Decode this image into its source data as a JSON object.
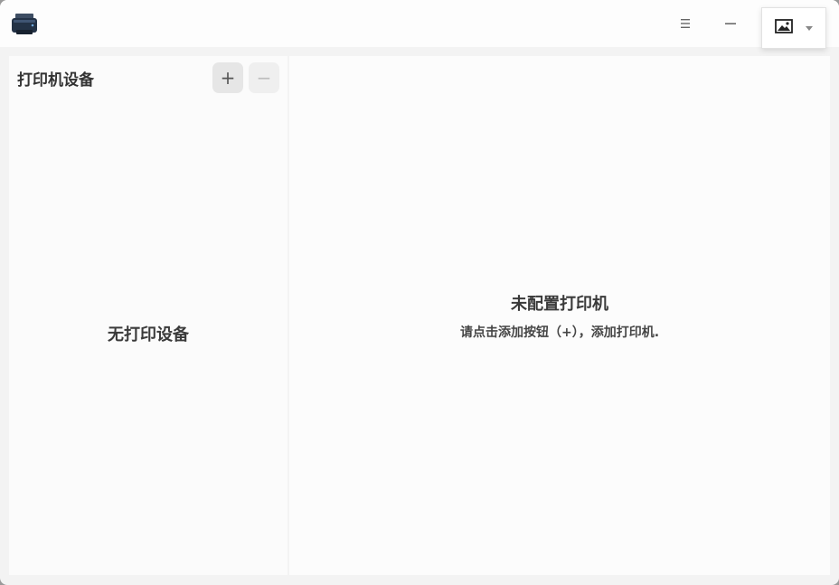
{
  "app": {
    "icon": "printer-icon"
  },
  "titlebar": {
    "menu_icon": "hamburger-menu-icon",
    "minimize_icon": "minimize-icon",
    "maximize_icon": "maximize-icon",
    "close_icon": "close-icon",
    "popup_icon": "image-icon"
  },
  "sidebar": {
    "title": "打印机设备",
    "add_label": "+",
    "remove_label": "−",
    "empty_text": "无打印设备"
  },
  "main": {
    "empty_title": "未配置打印机",
    "empty_hint": "请点击添加按钮（+），添加打印机."
  }
}
